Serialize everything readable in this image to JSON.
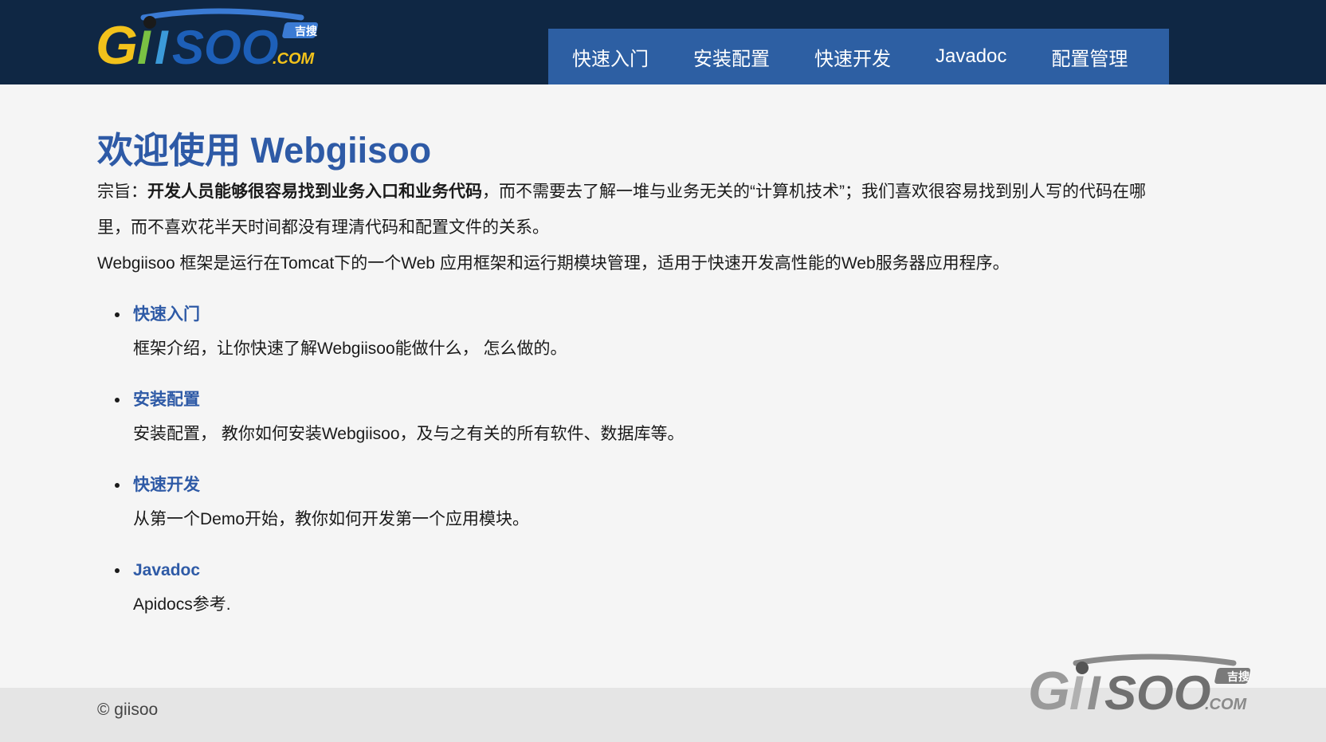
{
  "colors": {
    "header_bg": "#0f2744",
    "nav_bg": "#2d5fa3",
    "accent_blue": "#2e5aa6",
    "footer_bg": "#e5e5e5"
  },
  "brand": {
    "logo_main": "GIISOO",
    "logo_suffix": ".COM",
    "logo_badge": "吉搜"
  },
  "nav": {
    "items": [
      {
        "label": "快速入门"
      },
      {
        "label": "安装配置"
      },
      {
        "label": "快速开发"
      },
      {
        "label": "Javadoc"
      },
      {
        "label": "配置管理"
      }
    ]
  },
  "main": {
    "title": "欢迎使用 Webgiisoo",
    "purpose_prefix": "宗旨：",
    "purpose_bold": "开发人员能够很容易找到业务入口和业务代码",
    "purpose_rest": "，而不需要去了解一堆与业务无关的“计算机技术”；我们喜欢很容易找到别人写的代码在哪里，而不喜欢花半天时间都没有理清代码和配置文件的关系。",
    "intro": "Webgiisoo 框架是运行在Tomcat下的一个Web 应用框架和运行期模块管理，适用于快速开发高性能的Web服务器应用程序。",
    "features": [
      {
        "title": "快速入门",
        "desc": "框架介绍，让你快速了解Webgiisoo能做什么， 怎么做的。"
      },
      {
        "title": "安装配置",
        "desc": "安装配置， 教你如何安装Webgiisoo，及与之有关的所有软件、数据库等。"
      },
      {
        "title": "快速开发",
        "desc": "从第一个Demo开始，教你如何开发第一个应用模块。"
      },
      {
        "title": "Javadoc",
        "desc": "Apidocs参考."
      }
    ]
  },
  "footer": {
    "copyright": "© giisoo"
  }
}
